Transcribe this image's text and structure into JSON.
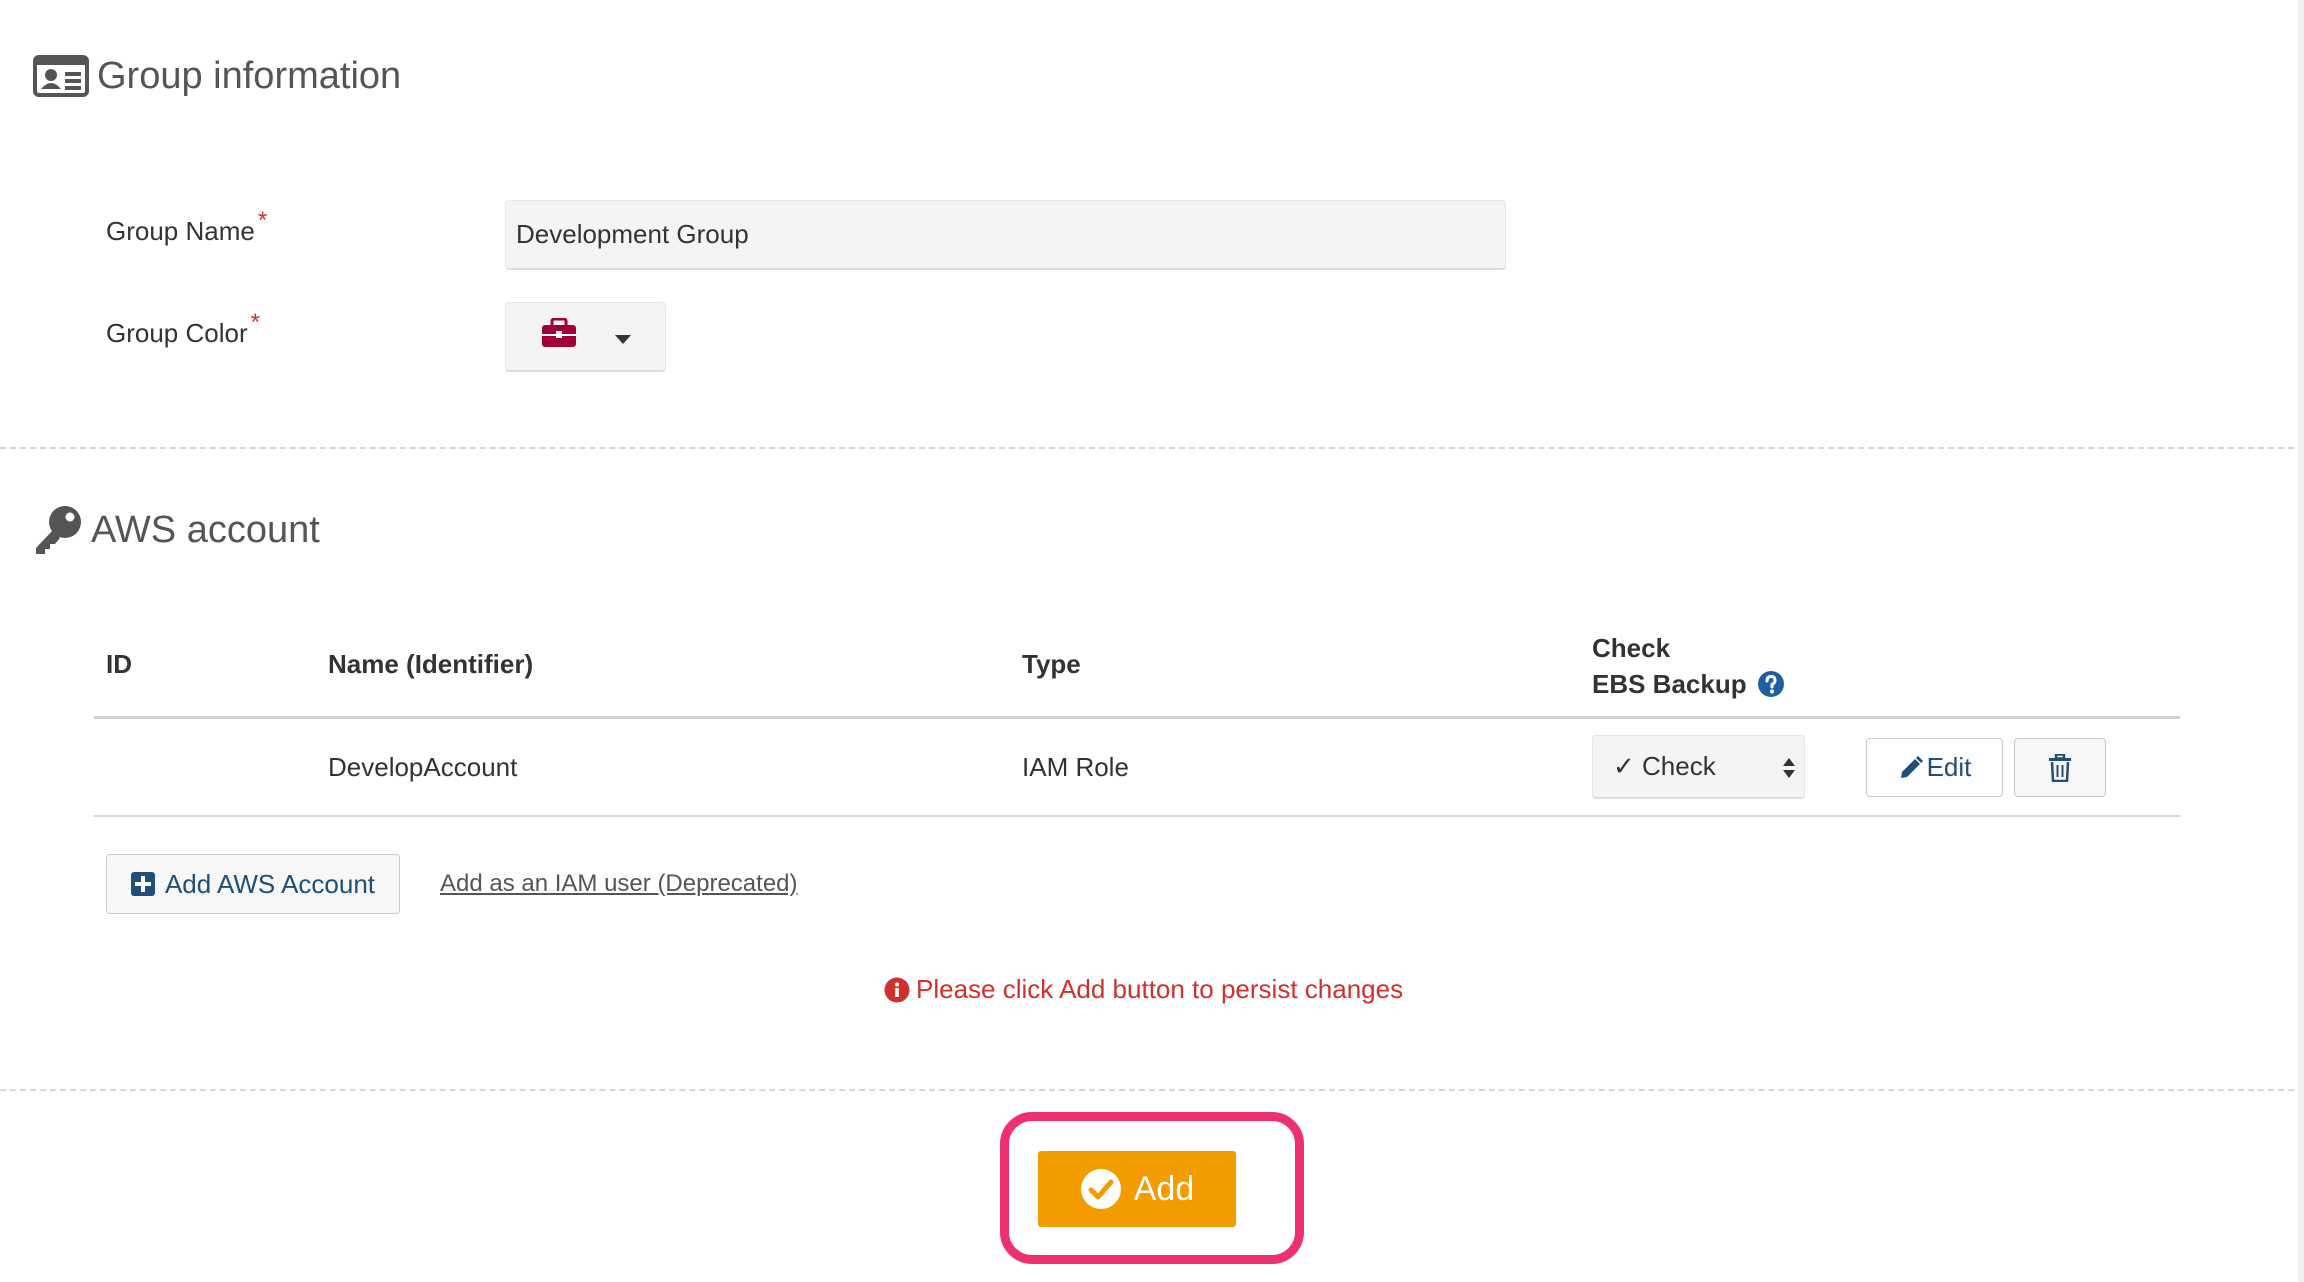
{
  "group_info": {
    "title": "Group information",
    "icon": "id-card-icon",
    "group_name_label": "Group Name",
    "group_name_value": "Development Group",
    "group_color_label": "Group Color",
    "required_mark": "*",
    "color_icon": "briefcase-icon",
    "color_value": "#a3003a"
  },
  "aws": {
    "title": "AWS account",
    "icon": "key-icon",
    "table": {
      "headers": {
        "id": "ID",
        "name": "Name (Identifier)",
        "type": "Type",
        "check_line1": "Check",
        "check_line2": "EBS Backup"
      },
      "rows": [
        {
          "id": "",
          "name": "DevelopAccount",
          "type": "IAM Role",
          "check": "✓ Check"
        }
      ]
    },
    "edit_label": "Edit",
    "add_account_label": "Add AWS Account",
    "add_iam_user_link": "Add as an IAM user (Deprecated)",
    "warning": "Please click Add button to persist changes"
  },
  "footer": {
    "add_label": "Add"
  },
  "colors": {
    "accent": "#f39c00",
    "highlight": "#ee2f72",
    "link_blue": "#1f4e79",
    "warning_red": "#d0312d"
  }
}
